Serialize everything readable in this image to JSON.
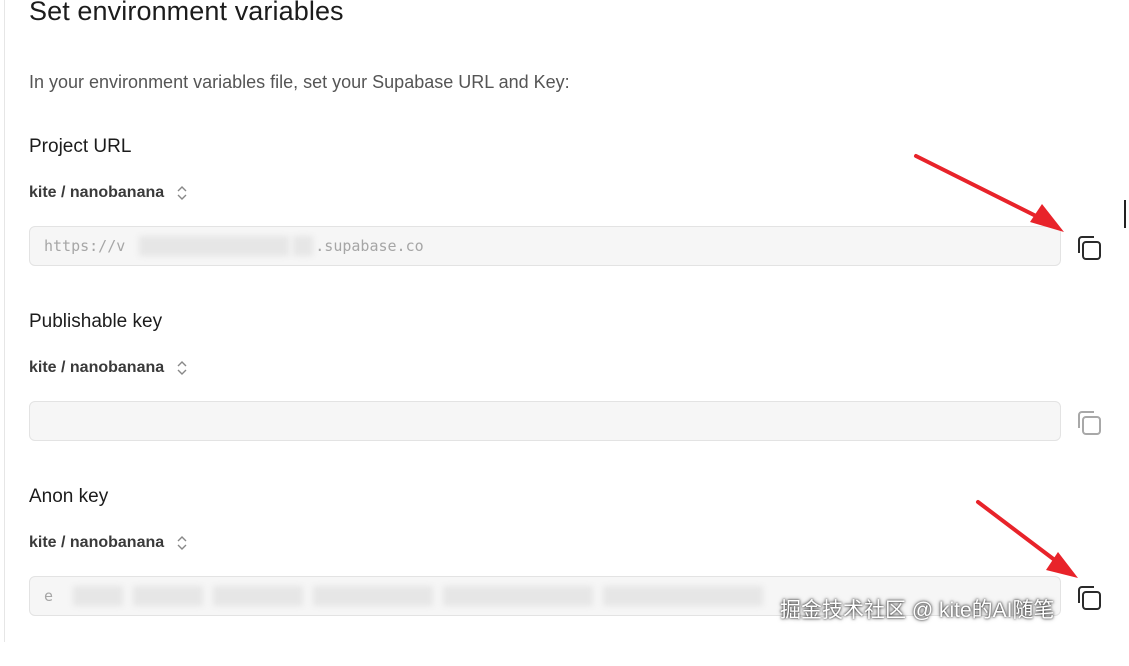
{
  "header": {
    "title": "Set environment variables",
    "intro": "In your environment variables file, set your Supabase URL and Key:"
  },
  "sections": [
    {
      "label": "Project URL",
      "project_selector": "kite / nanobanana",
      "field_prefix": "https://v",
      "field_suffix": ".supabase.co",
      "copy_icon": "copy-icon"
    },
    {
      "label": "Publishable key",
      "project_selector": "kite / nanobanana",
      "field_value": "",
      "copy_icon": "copy-icon"
    },
    {
      "label": "Anon key",
      "project_selector": "kite / nanobanana",
      "field_prefix": "e",
      "copy_icon": "copy-icon"
    }
  ],
  "annotations": {
    "arrow_color": "#e8232a"
  },
  "watermark": "掘金技术社区 @ kite的AI随笔",
  "colors": {
    "text_primary": "#1c1c1c",
    "text_secondary": "#555555",
    "field_bg": "#f6f6f6",
    "field_border": "#e3e3e3"
  }
}
